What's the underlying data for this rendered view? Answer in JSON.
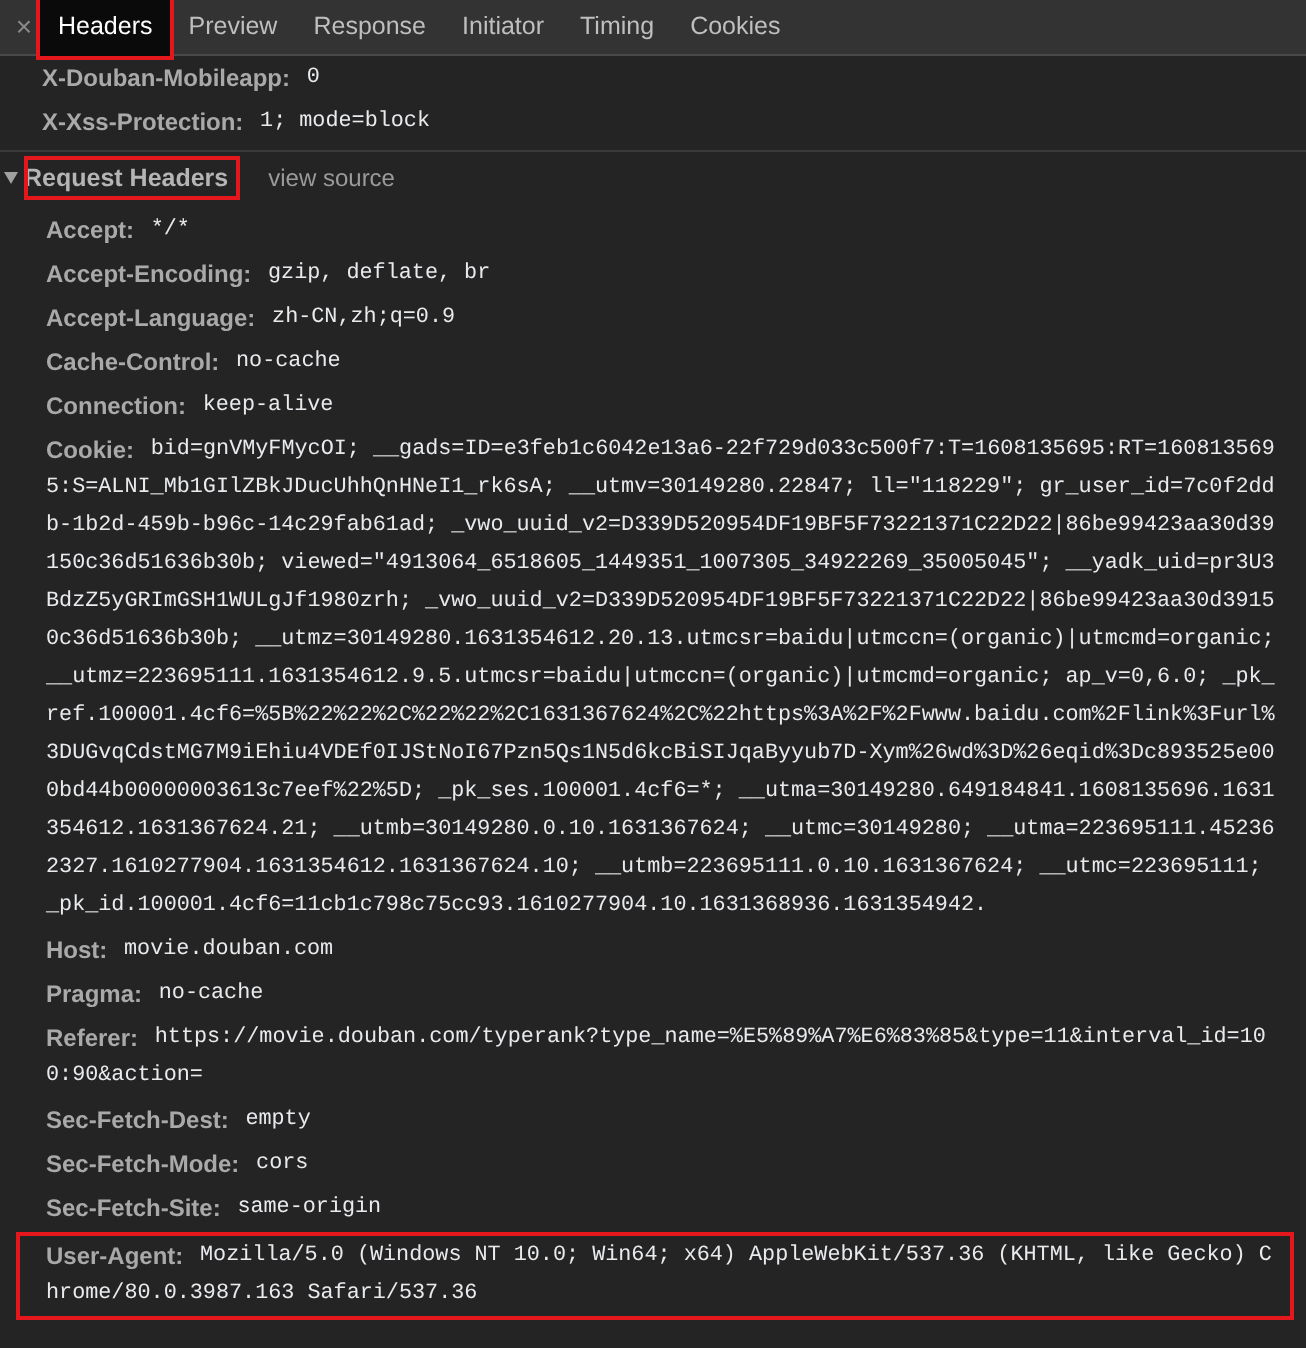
{
  "tabs_bar": {
    "close": "×",
    "tabs": [
      {
        "label": "Headers",
        "selected": true,
        "highlighted": true
      },
      {
        "label": "Preview",
        "selected": false,
        "highlighted": false
      },
      {
        "label": "Response",
        "selected": false,
        "highlighted": false
      },
      {
        "label": "Initiator",
        "selected": false,
        "highlighted": false
      },
      {
        "label": "Timing",
        "selected": false,
        "highlighted": false
      },
      {
        "label": "Cookies",
        "selected": false,
        "highlighted": false
      }
    ]
  },
  "response_headers": [
    {
      "name": "X-Douban-Mobileapp:",
      "value": "0",
      "highlighted": false
    },
    {
      "name": "X-Xss-Protection:",
      "value": "1; mode=block",
      "highlighted": false
    }
  ],
  "request_headers": {
    "title": "Request Headers",
    "expanded": true,
    "highlighted": true,
    "link": "view source",
    "headers": [
      {
        "name": "Accept:",
        "value": "*/*",
        "highlighted": false
      },
      {
        "name": "Accept-Encoding:",
        "value": "gzip, deflate, br",
        "highlighted": false
      },
      {
        "name": "Accept-Language:",
        "value": "zh-CN,zh;q=0.9",
        "highlighted": false
      },
      {
        "name": "Cache-Control:",
        "value": "no-cache",
        "highlighted": false
      },
      {
        "name": "Connection:",
        "value": "keep-alive",
        "highlighted": false
      },
      {
        "name": "Cookie:",
        "value": "bid=gnVMyFMycOI; __gads=ID=e3feb1c6042e13a6-22f729d033c500f7:T=1608135695:RT=1608135695:S=ALNI_Mb1GIlZBkJDucUhhQnHNeI1_rk6sA; __utmv=30149280.22847; ll=\"118229\"; gr_user_id=7c0f2ddb-1b2d-459b-b96c-14c29fab61ad; _vwo_uuid_v2=D339D520954DF19BF5F73221371C22D22|86be99423aa30d39150c36d51636b30b; viewed=\"4913064_6518605_1449351_1007305_34922269_35005045\"; __yadk_uid=pr3U3BdzZ5yGRImGSH1WULgJf1980zrh; _vwo_uuid_v2=D339D520954DF19BF5F73221371C22D22|86be99423aa30d39150c36d51636b30b; __utmz=30149280.1631354612.20.13.utmcsr=baidu|utmccn=(organic)|utmcmd=organic; __utmz=223695111.1631354612.9.5.utmcsr=baidu|utmccn=(organic)|utmcmd=organic; ap_v=0,6.0; _pk_ref.100001.4cf6=%5B%22%22%2C%22%22%2C1631367624%2C%22https%3A%2F%2Fwww.baidu.com%2Flink%3Furl%3DUGvqCdstMG7M9iEhiu4VDEf0IJStNoI67Pzn5Qs1N5d6kcBiSIJqaByyub7D-Xym%26wd%3D%26eqid%3Dc893525e000bd44b00000003613c7eef%22%5D; _pk_ses.100001.4cf6=*; __utma=30149280.649184841.1608135696.1631354612.1631367624.21; __utmb=30149280.0.10.1631367624; __utmc=30149280; __utma=223695111.452362327.1610277904.1631354612.1631367624.10; __utmb=223695111.0.10.1631367624; __utmc=223695111; _pk_id.100001.4cf6=11cb1c798c75cc93.1610277904.10.1631368936.1631354942.",
        "highlighted": false
      },
      {
        "name": "Host:",
        "value": "movie.douban.com",
        "highlighted": false
      },
      {
        "name": "Pragma:",
        "value": "no-cache",
        "highlighted": false
      },
      {
        "name": "Referer:",
        "value": "https://movie.douban.com/typerank?type_name=%E5%89%A7%E6%83%85&type=11&interval_id=100:90&action=",
        "highlighted": false
      },
      {
        "name": "Sec-Fetch-Dest:",
        "value": "empty",
        "highlighted": false
      },
      {
        "name": "Sec-Fetch-Mode:",
        "value": "cors",
        "highlighted": false
      },
      {
        "name": "Sec-Fetch-Site:",
        "value": "same-origin",
        "highlighted": false
      },
      {
        "name": "User-Agent:",
        "value": "Mozilla/5.0 (Windows NT 10.0; Win64; x64) AppleWebKit/537.36 (KHTML, like Gecko) Chrome/80.0.3987.163 Safari/537.36",
        "highlighted": true
      }
    ]
  }
}
